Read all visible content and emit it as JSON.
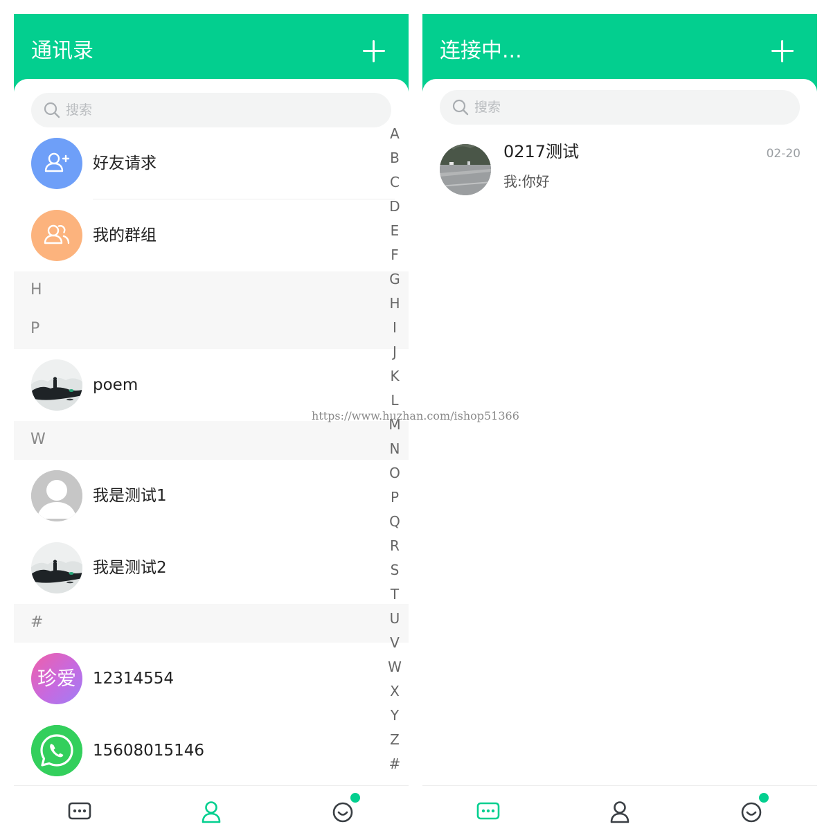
{
  "contacts_screen": {
    "header": {
      "title": "通讯录"
    },
    "search": {
      "placeholder": "搜索"
    },
    "fixed_items": [
      {
        "label": "好友请求",
        "icon": "add-user-icon",
        "color": "#6e9ff8"
      },
      {
        "label": "我的群组",
        "icon": "group-icon",
        "color": "#fcb37d"
      }
    ],
    "sections": {
      "h": "H",
      "p": "P",
      "w": "W",
      "hash": "#"
    },
    "contacts": [
      {
        "name": "poem",
        "avatar": "ink-landscape-avatar"
      },
      {
        "name": "我是测试1",
        "avatar": "default-person-avatar"
      },
      {
        "name": "我是测试2",
        "avatar": "ink-landscape-avatar"
      },
      {
        "name": "12314554",
        "avatar": "zhenai-logo-avatar",
        "avatar_text": "珍爱"
      },
      {
        "name": "15608015146",
        "avatar": "whatsapp-logo-avatar"
      }
    ],
    "index_letters": [
      "A",
      "B",
      "C",
      "D",
      "E",
      "F",
      "G",
      "H",
      "I",
      "J",
      "K",
      "L",
      "M",
      "N",
      "O",
      "P",
      "Q",
      "R",
      "S",
      "T",
      "U",
      "V",
      "W",
      "X",
      "Y",
      "Z",
      "#"
    ]
  },
  "chats_screen": {
    "header": {
      "title": "连接中..."
    },
    "search": {
      "placeholder": "搜索"
    },
    "conversations": [
      {
        "title": "0217测试",
        "preview": "我:你好",
        "time": "02-20",
        "avatar": "street-photo-avatar"
      }
    ]
  },
  "tabbar": {
    "tabs": [
      {
        "icon": "chat-bubble-icon"
      },
      {
        "icon": "contacts-icon"
      },
      {
        "icon": "smiley-icon",
        "has_dot": true
      }
    ]
  },
  "watermark": "https://www.huzhan.com/ishop51366",
  "colors": {
    "accent": "#03cf8f",
    "section_bg": "#f7f7f7",
    "search_bg": "#f3f4f4"
  }
}
